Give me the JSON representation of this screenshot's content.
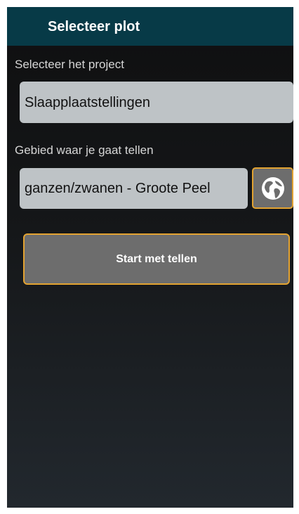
{
  "appbar": {
    "title": "Selecteer plot"
  },
  "project": {
    "label": "Selecteer het project",
    "value": "Slaapplaatstellingen"
  },
  "area": {
    "label": "Gebied waar je gaat tellen",
    "value": "ganzen/zwanen - Groote Peel",
    "map_button_icon": "globe-icon"
  },
  "start_button": {
    "label": "Start met tellen"
  },
  "colors": {
    "appbar": "#073a47",
    "field_bg": "#bec3c6",
    "button_bg": "#6d6d6d",
    "button_border": "#e3a331"
  }
}
